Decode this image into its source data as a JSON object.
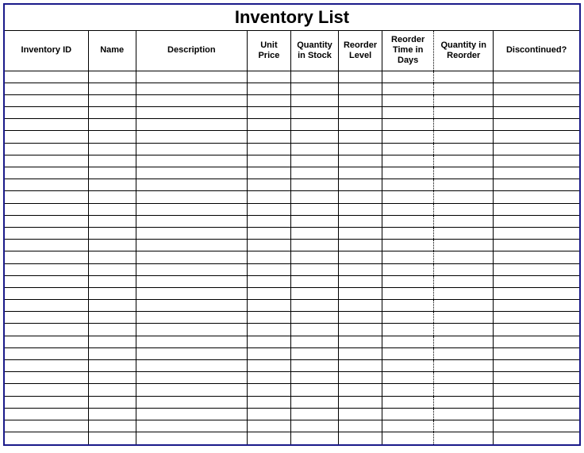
{
  "title": "Inventory List",
  "columns": [
    {
      "key": "inventory_id",
      "label": "Inventory ID"
    },
    {
      "key": "name",
      "label": "Name"
    },
    {
      "key": "description",
      "label": "Description"
    },
    {
      "key": "unit_price",
      "label": "Unit Price"
    },
    {
      "key": "quantity_in_stock",
      "label": "Quantity in Stock"
    },
    {
      "key": "reorder_level",
      "label": "Reorder Level"
    },
    {
      "key": "reorder_time_days",
      "label": "Reorder Time in Days"
    },
    {
      "key": "quantity_in_reorder",
      "label": "Quantity in Reorder"
    },
    {
      "key": "discontinued",
      "label": "Discontinued?"
    }
  ],
  "dotted_separator_before_index": 7,
  "rows": [
    {},
    {},
    {},
    {},
    {},
    {},
    {},
    {},
    {},
    {},
    {},
    {},
    {},
    {},
    {},
    {},
    {},
    {},
    {},
    {},
    {},
    {},
    {},
    {},
    {},
    {},
    {},
    {},
    {},
    {},
    {}
  ]
}
